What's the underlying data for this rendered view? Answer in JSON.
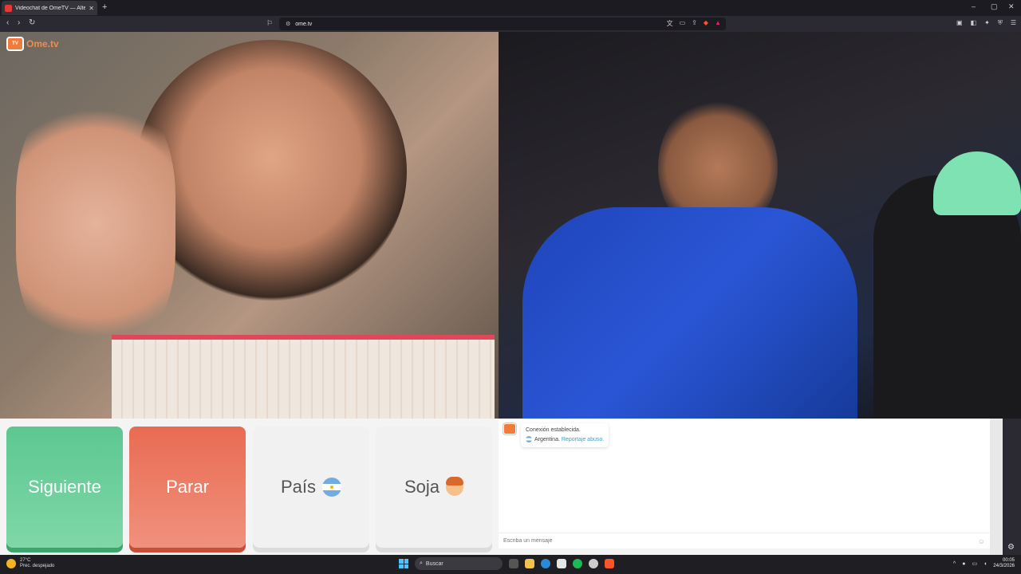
{
  "browser": {
    "tab_title": "Videochat de OmeTV — Alte",
    "url": "ome.tv",
    "new_tab_glyph": "+",
    "close_glyph": "✕"
  },
  "page": {
    "logo_text": "Ome.tv",
    "logo_badge": "Ome\ntv"
  },
  "controls": {
    "next_label": "Siguiente",
    "stop_label": "Parar",
    "country_label": "País",
    "gender_label": "Soja"
  },
  "chat": {
    "status_line": "Conexión establecida.",
    "country": "Argentina.",
    "report_link": "Reportaje abuso.",
    "input_placeholder": "Escriba un mensaje"
  },
  "taskbar": {
    "temperature": "27°C",
    "weather": "Prec. despejado",
    "search_label": "Buscar",
    "time": "00:05",
    "date": "24/3/2026"
  },
  "colors": {
    "next": "#5cc792",
    "stop": "#e96b52",
    "logo": "#f07b3a"
  }
}
